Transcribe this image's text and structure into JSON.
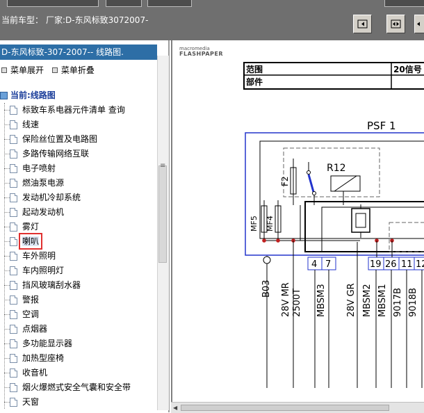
{
  "top_bar": {
    "car_model_label": "当前车型：",
    "car_model_value": "厂家:D-东风标致3072007-",
    "nav_buttons": [
      "first-page-icon",
      "prev-next-icon",
      "last-page-icon"
    ]
  },
  "left_panel": {
    "title": "D-东风标致-307-2007-- 线路图.",
    "expand_label": "菜单展开",
    "collapse_label": "菜单折叠",
    "current_label": "当前:线路图",
    "selected_index": 9,
    "items": [
      "标致车系电器元件清单 查询",
      "线速",
      "保险丝位置及电路图",
      "多路传输网络互联",
      "电子喷射",
      "燃油泵电源",
      "发动机冷却系统",
      "起动发动机",
      "雾灯",
      "喇叭",
      "车外照明",
      "车内照明灯",
      "挡风玻璃刮水器",
      "警报",
      "空调",
      "点烟器",
      "多功能显示器",
      "加热型座椅",
      "收音机",
      "烟火爆燃式安全气囊和安全带",
      "天窗"
    ]
  },
  "document": {
    "brand_line1": "macromedia",
    "brand_line2": "FLASHPAPER",
    "table": {
      "row1_label": "范围",
      "row1_right": "20信号",
      "row2_label": "部件"
    },
    "diagram": {
      "module_label": "PSF 1",
      "fuse_f2": "F2",
      "relay_r12": "R12",
      "fuse_mf5": "MF5",
      "fuse_mf4": "MF4",
      "pins": [
        "4",
        "7",
        "19",
        "26",
        "11",
        "12"
      ],
      "wires": [
        "B03",
        "28V MR",
        "2500T",
        "MBSM3",
        "28V GR",
        "MBSM2",
        "MBSM1",
        "9017B",
        "9018B"
      ]
    }
  },
  "colors": {
    "toolbar_bg": "#6f6f6f",
    "title_bg": "#2d6ea6",
    "diagram_border": "#2233cc",
    "selection_outline": "#e03030",
    "node_red": "#c02020"
  }
}
